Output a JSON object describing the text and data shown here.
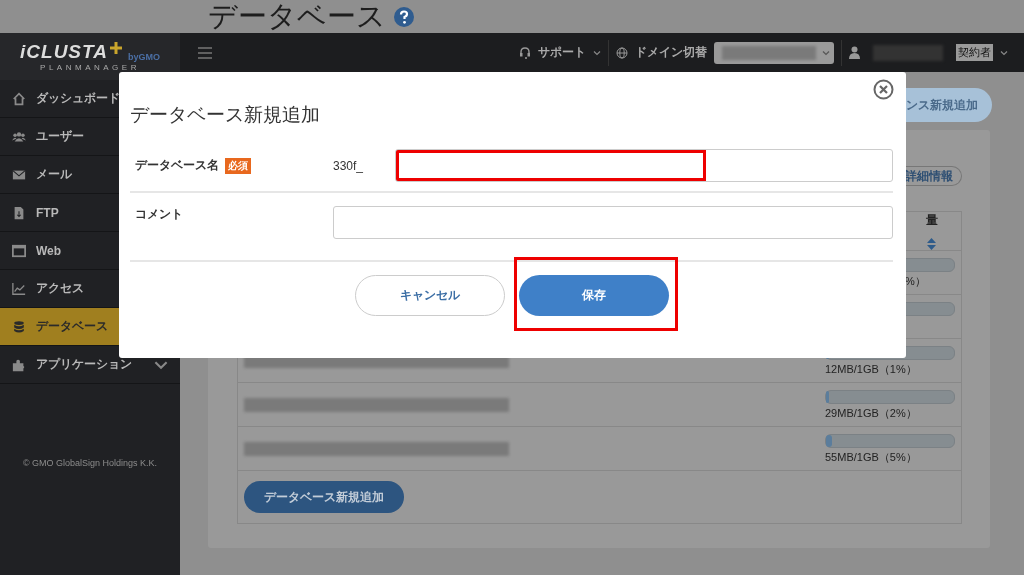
{
  "page": {
    "title": "データベース"
  },
  "logo": {
    "name": "iCLUSTA",
    "by": "byGMO",
    "subtitle": "PLANMANAGER"
  },
  "sidebar": {
    "items": [
      {
        "label": "ダッシュボード",
        "selected": false
      },
      {
        "label": "ユーザー",
        "selected": false
      },
      {
        "label": "メール",
        "selected": false
      },
      {
        "label": "FTP",
        "selected": false
      },
      {
        "label": "Web",
        "selected": false
      },
      {
        "label": "アクセス",
        "selected": false
      },
      {
        "label": "データベース",
        "selected": true
      },
      {
        "label": "アプリケーション",
        "selected": false,
        "expandable": true
      }
    ],
    "copyright": "© GMO GlobalSign Holdings K.K."
  },
  "header": {
    "support": "サポート",
    "domain_switch": "ドメイン切替",
    "role_badge": "契約者"
  },
  "top_action": {
    "label": "ンス新規追加"
  },
  "detail_button": {
    "label": "詳細情報"
  },
  "table": {
    "columns": [
      {
        "label": "量"
      }
    ],
    "rows": [
      {
        "kind": "covered",
        "reading": "%）"
      },
      {
        "kind": "covered"
      },
      {
        "kind": "full",
        "level": 0.01,
        "reading": "12MB/1GB（1%）"
      },
      {
        "kind": "full",
        "level": 0.02,
        "reading": "29MB/1GB（2%）"
      },
      {
        "kind": "full",
        "level": 0.05,
        "reading": "55MB/1GB（5%）"
      }
    ]
  },
  "add_button": {
    "label": "データベース新規追加"
  },
  "modal": {
    "title": "データベース新規追加",
    "fields": [
      {
        "label": "データベース名",
        "required_badge": "必須",
        "prefix": "330f_",
        "highlighted": true
      },
      {
        "label": "コメント",
        "highlighted": false
      }
    ],
    "buttons": [
      {
        "label": "キャンセル",
        "kind": "secondary",
        "highlighted": false
      },
      {
        "label": "保存",
        "kind": "primary",
        "highlighted": true
      }
    ]
  }
}
